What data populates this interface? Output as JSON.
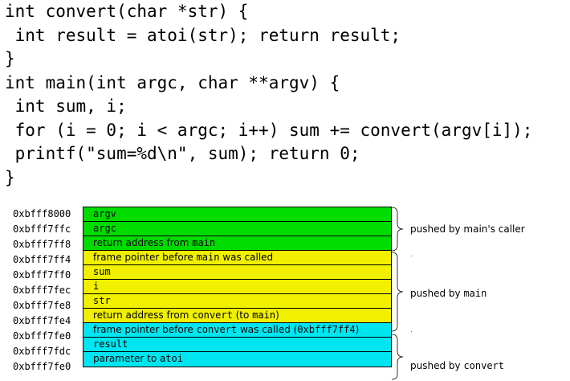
{
  "code": {
    "lines": [
      "int convert(char *str) {",
      " int result = atoi(str); return result;",
      "}",
      "int main(int argc, char **argv) {",
      " int sum, i;",
      " for (i = 0; i < argc; i++) sum += convert(argv[i]);",
      " printf(\"sum=%d\\n\", sum); return 0;",
      "}"
    ]
  },
  "stack": {
    "rows": [
      {
        "address": "0xbfff8000",
        "color": "green",
        "parts": [
          {
            "t": "argv",
            "mono": true
          }
        ]
      },
      {
        "address": "0xbfff7ffc",
        "color": "green",
        "parts": [
          {
            "t": "argc",
            "mono": true
          }
        ]
      },
      {
        "address": "0xbfff7ff8",
        "color": "green",
        "parts": [
          {
            "t": "return address from ",
            "mono": false
          },
          {
            "t": "main",
            "mono": true
          }
        ]
      },
      {
        "address": "0xbfff7ff4",
        "color": "yellow",
        "parts": [
          {
            "t": "frame pointer before ",
            "mono": false
          },
          {
            "t": "main",
            "mono": true
          },
          {
            "t": " was called",
            "mono": false
          }
        ]
      },
      {
        "address": "0xbfff7ff0",
        "color": "yellow",
        "parts": [
          {
            "t": "sum",
            "mono": true
          }
        ]
      },
      {
        "address": "0xbfff7fec",
        "color": "yellow",
        "parts": [
          {
            "t": "i",
            "mono": true
          }
        ]
      },
      {
        "address": "0xbfff7fe8",
        "color": "yellow",
        "parts": [
          {
            "t": "str",
            "mono": true
          }
        ]
      },
      {
        "address": "0xbfff7fe4",
        "color": "yellow",
        "parts": [
          {
            "t": "return address from ",
            "mono": false
          },
          {
            "t": "convert",
            "mono": true
          },
          {
            "t": " (to ",
            "mono": false
          },
          {
            "t": "main",
            "mono": true
          },
          {
            "t": ")",
            "mono": false
          }
        ]
      },
      {
        "address": "0xbfff7fe0",
        "color": "cyan",
        "parts": [
          {
            "t": "frame pointer before ",
            "mono": false
          },
          {
            "t": "convert",
            "mono": true
          },
          {
            "t": " was called (",
            "mono": false
          },
          {
            "t": "0xbfff7ff4",
            "mono": true
          },
          {
            "t": ")",
            "mono": false
          }
        ]
      },
      {
        "address": "0xbfff7fdc",
        "color": "cyan",
        "parts": [
          {
            "t": "result",
            "mono": true
          }
        ]
      },
      {
        "address": "0xbfff7fe0",
        "color": "cyan",
        "parts": [
          {
            "t": "parameter to ",
            "mono": false
          },
          {
            "t": "atoi",
            "mono": true
          }
        ]
      }
    ]
  },
  "groups": [
    {
      "parts": [
        {
          "t": "pushed by main's caller",
          "mono": false
        }
      ]
    },
    {
      "parts": [
        {
          "t": "pushed by ",
          "mono": false
        },
        {
          "t": "main",
          "mono": true
        }
      ]
    },
    {
      "parts": [
        {
          "t": "pushed by ",
          "mono": false
        },
        {
          "t": "convert",
          "mono": true
        }
      ]
    }
  ],
  "colors": {
    "green": "#00dc00",
    "yellow": "#f0f000",
    "cyan": "#00e6f0"
  }
}
